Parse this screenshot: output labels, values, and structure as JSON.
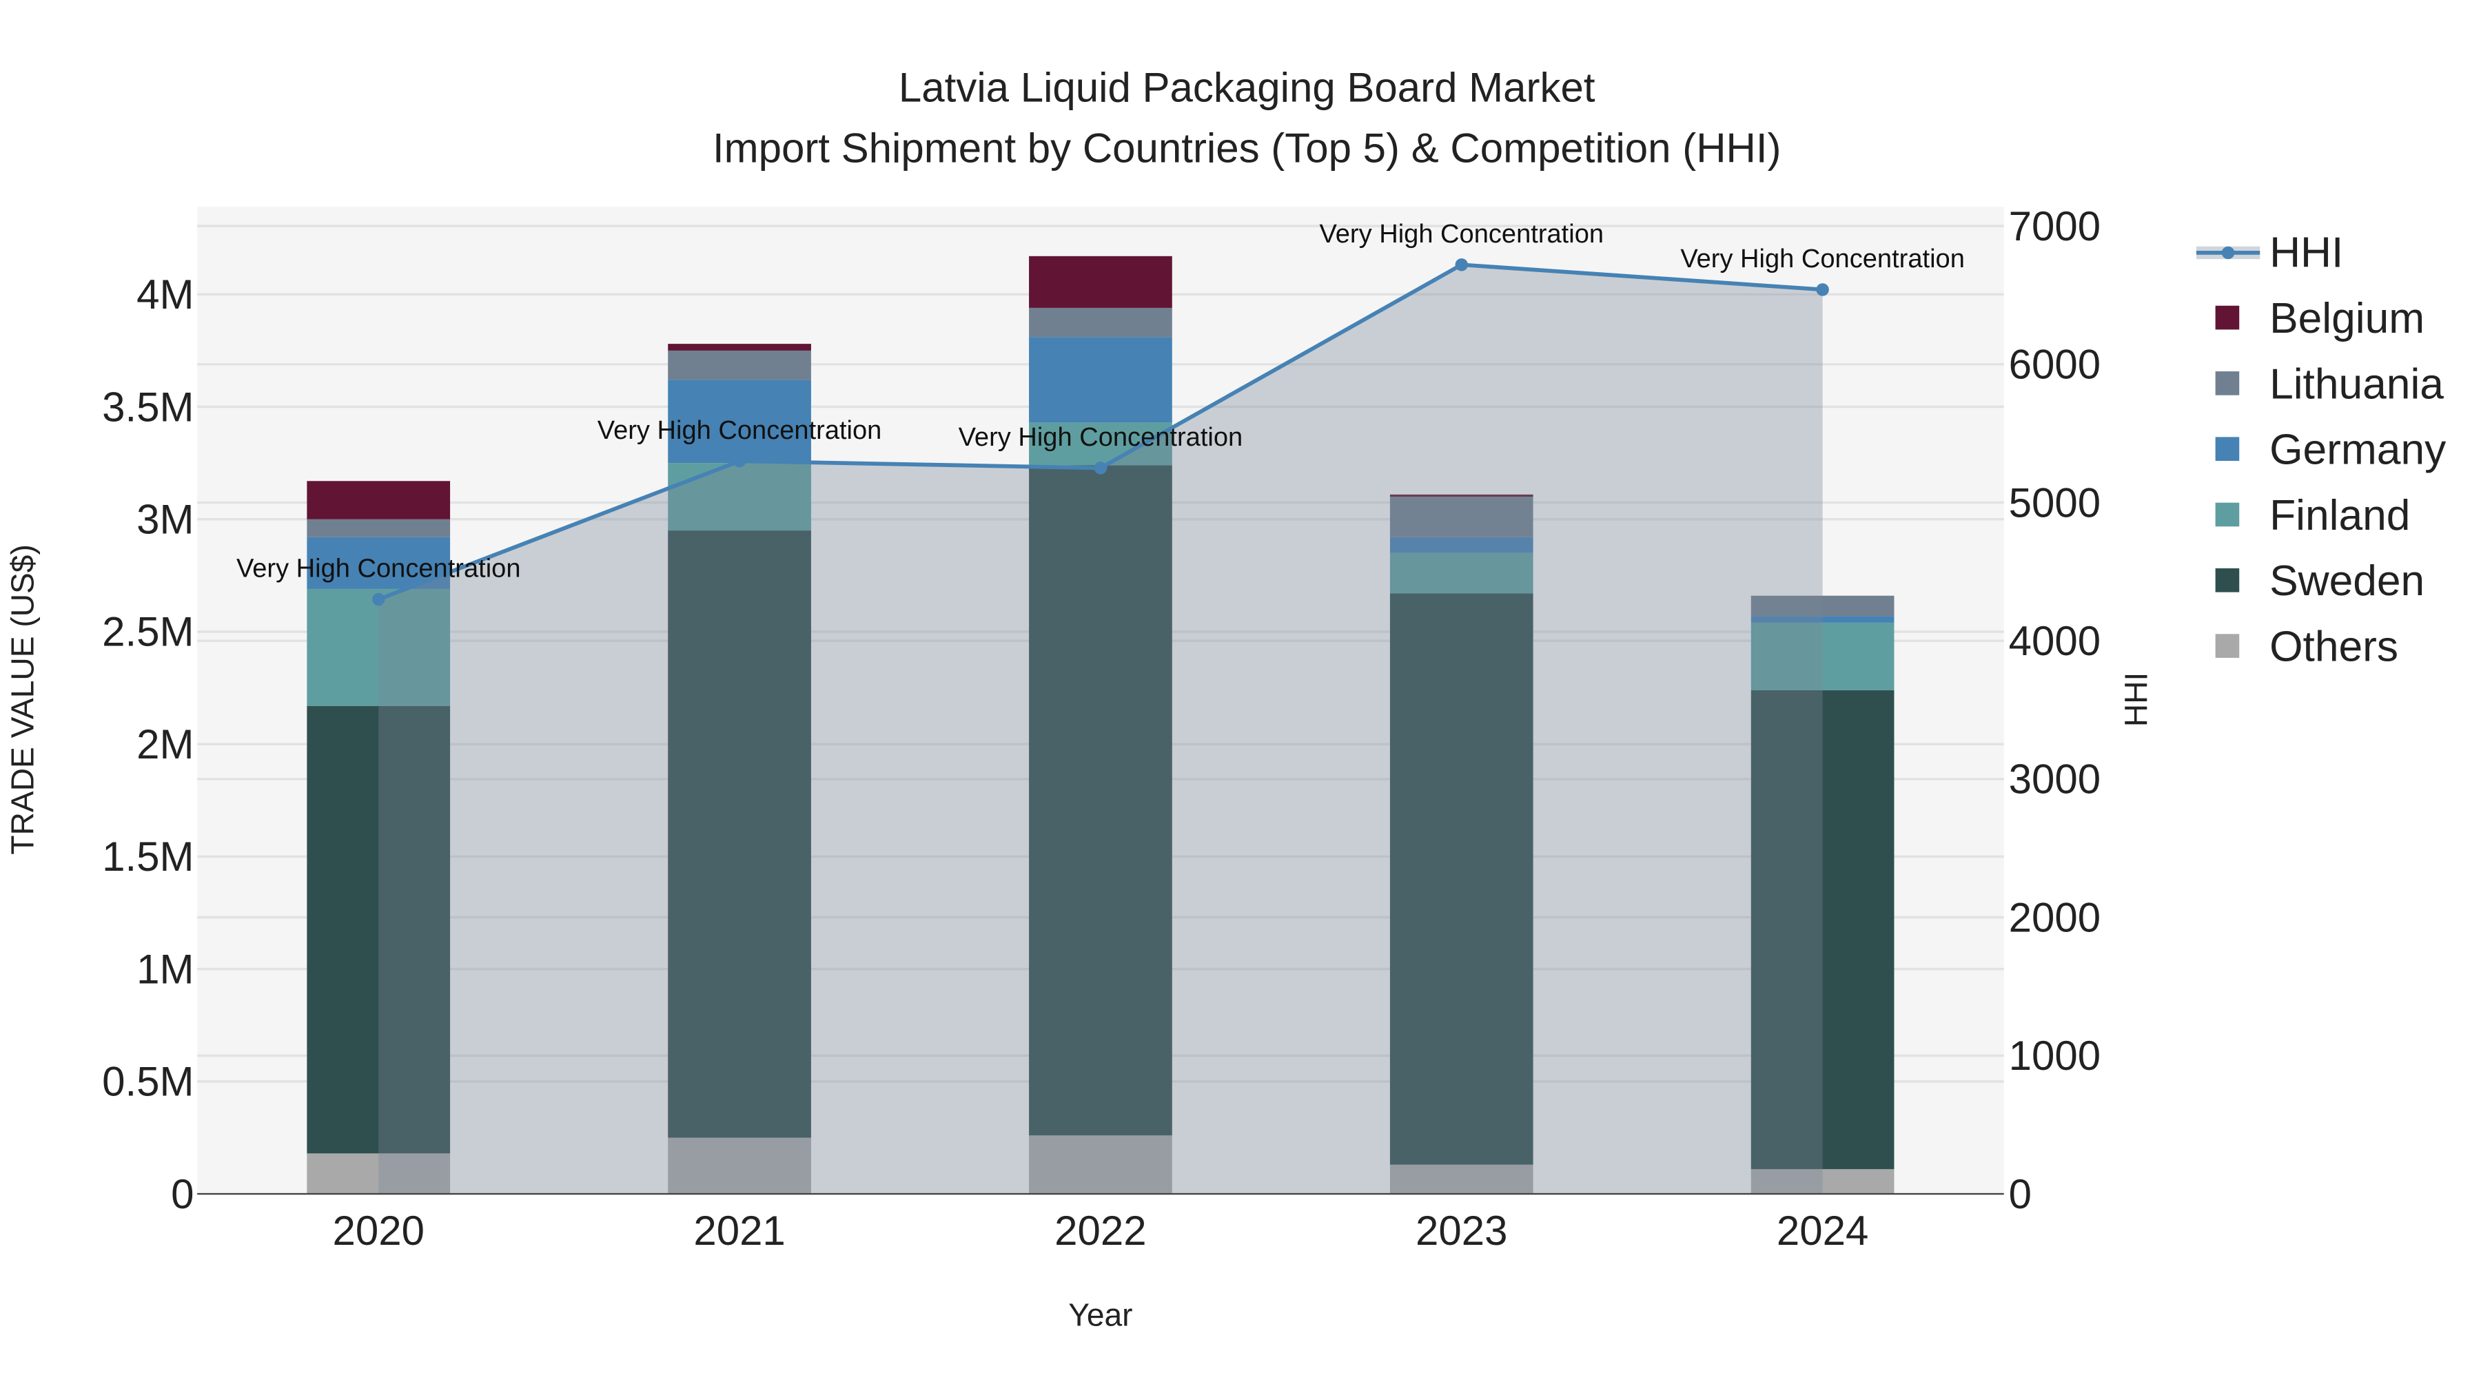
{
  "chart_data": {
    "type": "bar",
    "title": "Latvia Liquid Packaging Board Market",
    "subtitle": "Import Shipment by Countries (Top 5) & Competition (HHI)",
    "xlabel": "Year",
    "ylabel": "TRADE VALUE (US$)",
    "y2label": "HHI",
    "categories": [
      "2020",
      "2021",
      "2022",
      "2023",
      "2024"
    ],
    "ylim": [
      0,
      4390000
    ],
    "y2lim": [
      0,
      7140
    ],
    "yticks": [
      0,
      500000,
      1000000,
      1500000,
      2000000,
      2500000,
      3000000,
      3500000,
      4000000
    ],
    "ytick_labels": [
      "0",
      "0.5M",
      "1M",
      "1.5M",
      "2M",
      "2.5M",
      "3M",
      "3.5M",
      "4M"
    ],
    "y2ticks": [
      0,
      1000,
      2000,
      3000,
      4000,
      5000,
      6000,
      7000
    ],
    "y2tick_labels": [
      "0",
      "1000",
      "2000",
      "3000",
      "4000",
      "5000",
      "6000",
      "7000"
    ],
    "grid": true,
    "legend_position": "right",
    "stack_order": [
      "Others",
      "Sweden",
      "Finland",
      "Germany",
      "Lithuania",
      "Belgium"
    ],
    "series": [
      {
        "name": "Others",
        "color": "#A9A9A9",
        "values": [
          180000,
          250000,
          260000,
          130000,
          110000
        ]
      },
      {
        "name": "Sweden",
        "color": "#2F4F4F",
        "values": [
          1990000,
          2700000,
          2980000,
          2540000,
          2130000
        ]
      },
      {
        "name": "Finland",
        "color": "#5F9EA0",
        "values": [
          520000,
          300000,
          190000,
          180000,
          300000
        ]
      },
      {
        "name": "Germany",
        "color": "#4682B4",
        "values": [
          230000,
          370000,
          380000,
          70000,
          30000
        ]
      },
      {
        "name": "Lithuania",
        "color": "#708090",
        "values": [
          80000,
          130000,
          130000,
          180000,
          90000
        ]
      },
      {
        "name": "Belgium",
        "color": "#611434",
        "values": [
          170000,
          30000,
          230000,
          10000,
          0
        ]
      }
    ],
    "line_series": {
      "name": "HHI",
      "color": "#4682B4",
      "axis": "right",
      "values": [
        4300,
        5300,
        5250,
        6720,
        6540
      ],
      "annotations": [
        "Very High Concentration",
        "Very High Concentration",
        "Very High Concentration",
        "Very High Concentration",
        "Very High Concentration"
      ]
    },
    "legend": [
      "HHI",
      "Belgium",
      "Lithuania",
      "Germany",
      "Finland",
      "Sweden",
      "Others"
    ]
  }
}
